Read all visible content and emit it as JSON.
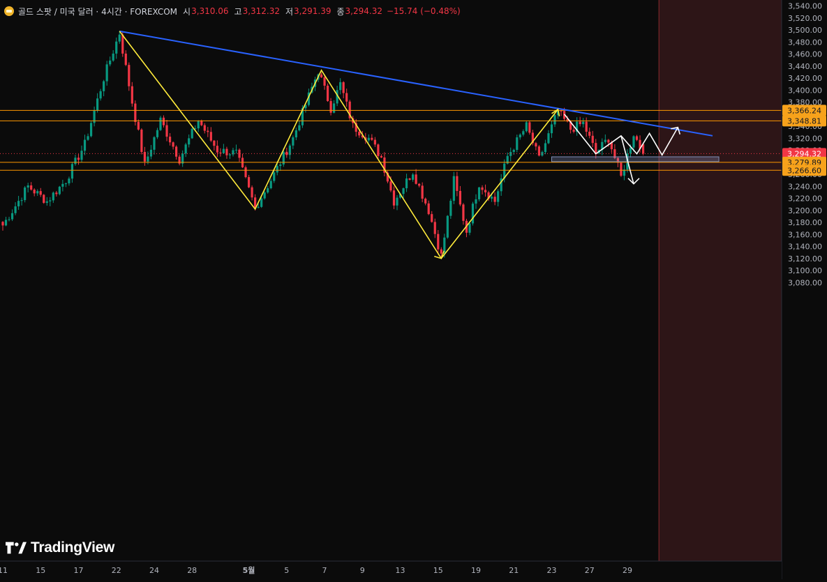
{
  "header": {
    "title": "골드 스팟 / 미국 달러 · 4시간 · FOREXCOM",
    "open_label": "시",
    "open_value": "3,310.06",
    "high_label": "고",
    "high_value": "3,312.32",
    "low_label": "저",
    "low_value": "3,291.39",
    "close_label": "종",
    "close_value": "3,294.32",
    "change": "−15.74 (−0.48%)"
  },
  "brand": {
    "name": "TradingView"
  },
  "colors": {
    "background": "#0b0b0b",
    "up": "#089981",
    "down": "#f23645",
    "trendline": "#2962ff",
    "zigzag": "#ffeb3b",
    "level": "#ff9800",
    "future_zone": "#2d1517",
    "future_border": "#8a2a2e",
    "projection": "#ffffff",
    "zone_box": "#7f8fb8"
  },
  "chart_data": {
    "type": "candlestick",
    "symbol": "XAUUSD",
    "timeframe": "4시간",
    "ylim": [
      3080,
      3540
    ],
    "y_ticks": [
      "3,080.00",
      "3,100.00",
      "3,120.00",
      "3,140.00",
      "3,160.00",
      "3,180.00",
      "3,200.00",
      "3,220.00",
      "3,240.00",
      "3,260.00",
      "3,280.00",
      "3,300.00",
      "3,320.00",
      "3,340.00",
      "3,360.00",
      "3,380.00",
      "3,400.00",
      "3,420.00",
      "3,440.00",
      "3,460.00",
      "3,480.00",
      "3,500.00",
      "3,520.00",
      "3,540.00"
    ],
    "x_ticks": [
      {
        "label": "11",
        "i": 0
      },
      {
        "label": "15",
        "i": 12
      },
      {
        "label": "17",
        "i": 24
      },
      {
        "label": "22",
        "i": 36
      },
      {
        "label": "24",
        "i": 48
      },
      {
        "label": "28",
        "i": 60
      },
      {
        "label": "5월",
        "i": 78
      },
      {
        "label": "5",
        "i": 90
      },
      {
        "label": "7",
        "i": 102
      },
      {
        "label": "9",
        "i": 114
      },
      {
        "label": "13",
        "i": 126
      },
      {
        "label": "15",
        "i": 138
      },
      {
        "label": "19",
        "i": 150
      },
      {
        "label": "21",
        "i": 162
      },
      {
        "label": "23",
        "i": 174
      },
      {
        "label": "27",
        "i": 186
      },
      {
        "label": "29",
        "i": 198
      }
    ],
    "candles": [],
    "key_points": [
      {
        "i": 0,
        "price": 3175
      },
      {
        "i": 8,
        "price": 3240
      },
      {
        "i": 14,
        "price": 3215
      },
      {
        "i": 20,
        "price": 3250
      },
      {
        "i": 26,
        "price": 3310
      },
      {
        "i": 32,
        "price": 3420
      },
      {
        "i": 37,
        "price": 3495
      },
      {
        "i": 41,
        "price": 3380
      },
      {
        "i": 45,
        "price": 3275
      },
      {
        "i": 50,
        "price": 3350
      },
      {
        "i": 56,
        "price": 3285
      },
      {
        "i": 62,
        "price": 3350
      },
      {
        "i": 68,
        "price": 3300
      },
      {
        "i": 74,
        "price": 3295
      },
      {
        "i": 80,
        "price": 3204
      },
      {
        "i": 86,
        "price": 3260
      },
      {
        "i": 92,
        "price": 3320
      },
      {
        "i": 100,
        "price": 3432
      },
      {
        "i": 104,
        "price": 3370
      },
      {
        "i": 107,
        "price": 3410
      },
      {
        "i": 111,
        "price": 3340
      },
      {
        "i": 116,
        "price": 3320
      },
      {
        "i": 120,
        "price": 3288
      },
      {
        "i": 124,
        "price": 3215
      },
      {
        "i": 130,
        "price": 3265
      },
      {
        "i": 135,
        "price": 3200
      },
      {
        "i": 139,
        "price": 3124
      },
      {
        "i": 143,
        "price": 3250
      },
      {
        "i": 147,
        "price": 3165
      },
      {
        "i": 151,
        "price": 3245
      },
      {
        "i": 156,
        "price": 3215
      },
      {
        "i": 160,
        "price": 3290
      },
      {
        "i": 166,
        "price": 3340
      },
      {
        "i": 170,
        "price": 3285
      },
      {
        "i": 176,
        "price": 3365
      },
      {
        "i": 180,
        "price": 3335
      },
      {
        "i": 184,
        "price": 3345
      },
      {
        "i": 188,
        "price": 3295
      },
      {
        "i": 192,
        "price": 3320
      },
      {
        "i": 196,
        "price": 3255
      },
      {
        "i": 200,
        "price": 3328
      },
      {
        "i": 203,
        "price": 3294
      }
    ],
    "price_levels": [
      {
        "value": 3366.24,
        "label": "3,366.24",
        "color": "#ff9800"
      },
      {
        "value": 3348.81,
        "label": "3,348.81",
        "color": "#ff9800"
      },
      {
        "value": 3294.32,
        "label": "3,294.32",
        "color": "#f23645",
        "kind": "current"
      },
      {
        "value": 3279.89,
        "label": "3,279.89",
        "color": "#ff9800"
      },
      {
        "value": 3266.6,
        "label": "3,266.60",
        "color": "#ff9800"
      }
    ],
    "trendline": {
      "from": {
        "i": 37,
        "price": 3498
      },
      "to": {
        "i": 225,
        "price": 3324
      }
    },
    "zigzag": [
      {
        "i": 37,
        "price": 3498
      },
      {
        "i": 80,
        "price": 3202
      },
      {
        "i": 101,
        "price": 3433
      },
      {
        "i": 139,
        "price": 3120
      },
      {
        "i": 176,
        "price": 3368
      }
    ],
    "projection_path": [
      {
        "i": 178,
        "price": 3360
      },
      {
        "i": 188,
        "price": 3294
      },
      {
        "i": 196,
        "price": 3324
      },
      {
        "i": 201,
        "price": 3294
      },
      {
        "i": 205,
        "price": 3328
      },
      {
        "i": 209,
        "price": 3292
      },
      {
        "i": 214,
        "price": 3338
      }
    ],
    "projection_drop": {
      "from": {
        "i": 196,
        "price": 3324
      },
      "to": {
        "i": 200,
        "price": 3244
      }
    },
    "zone_box": {
      "i_from": 174,
      "i_to": 227,
      "price_top": 3289,
      "price_bottom": 3281
    },
    "future_start_i": 208
  }
}
